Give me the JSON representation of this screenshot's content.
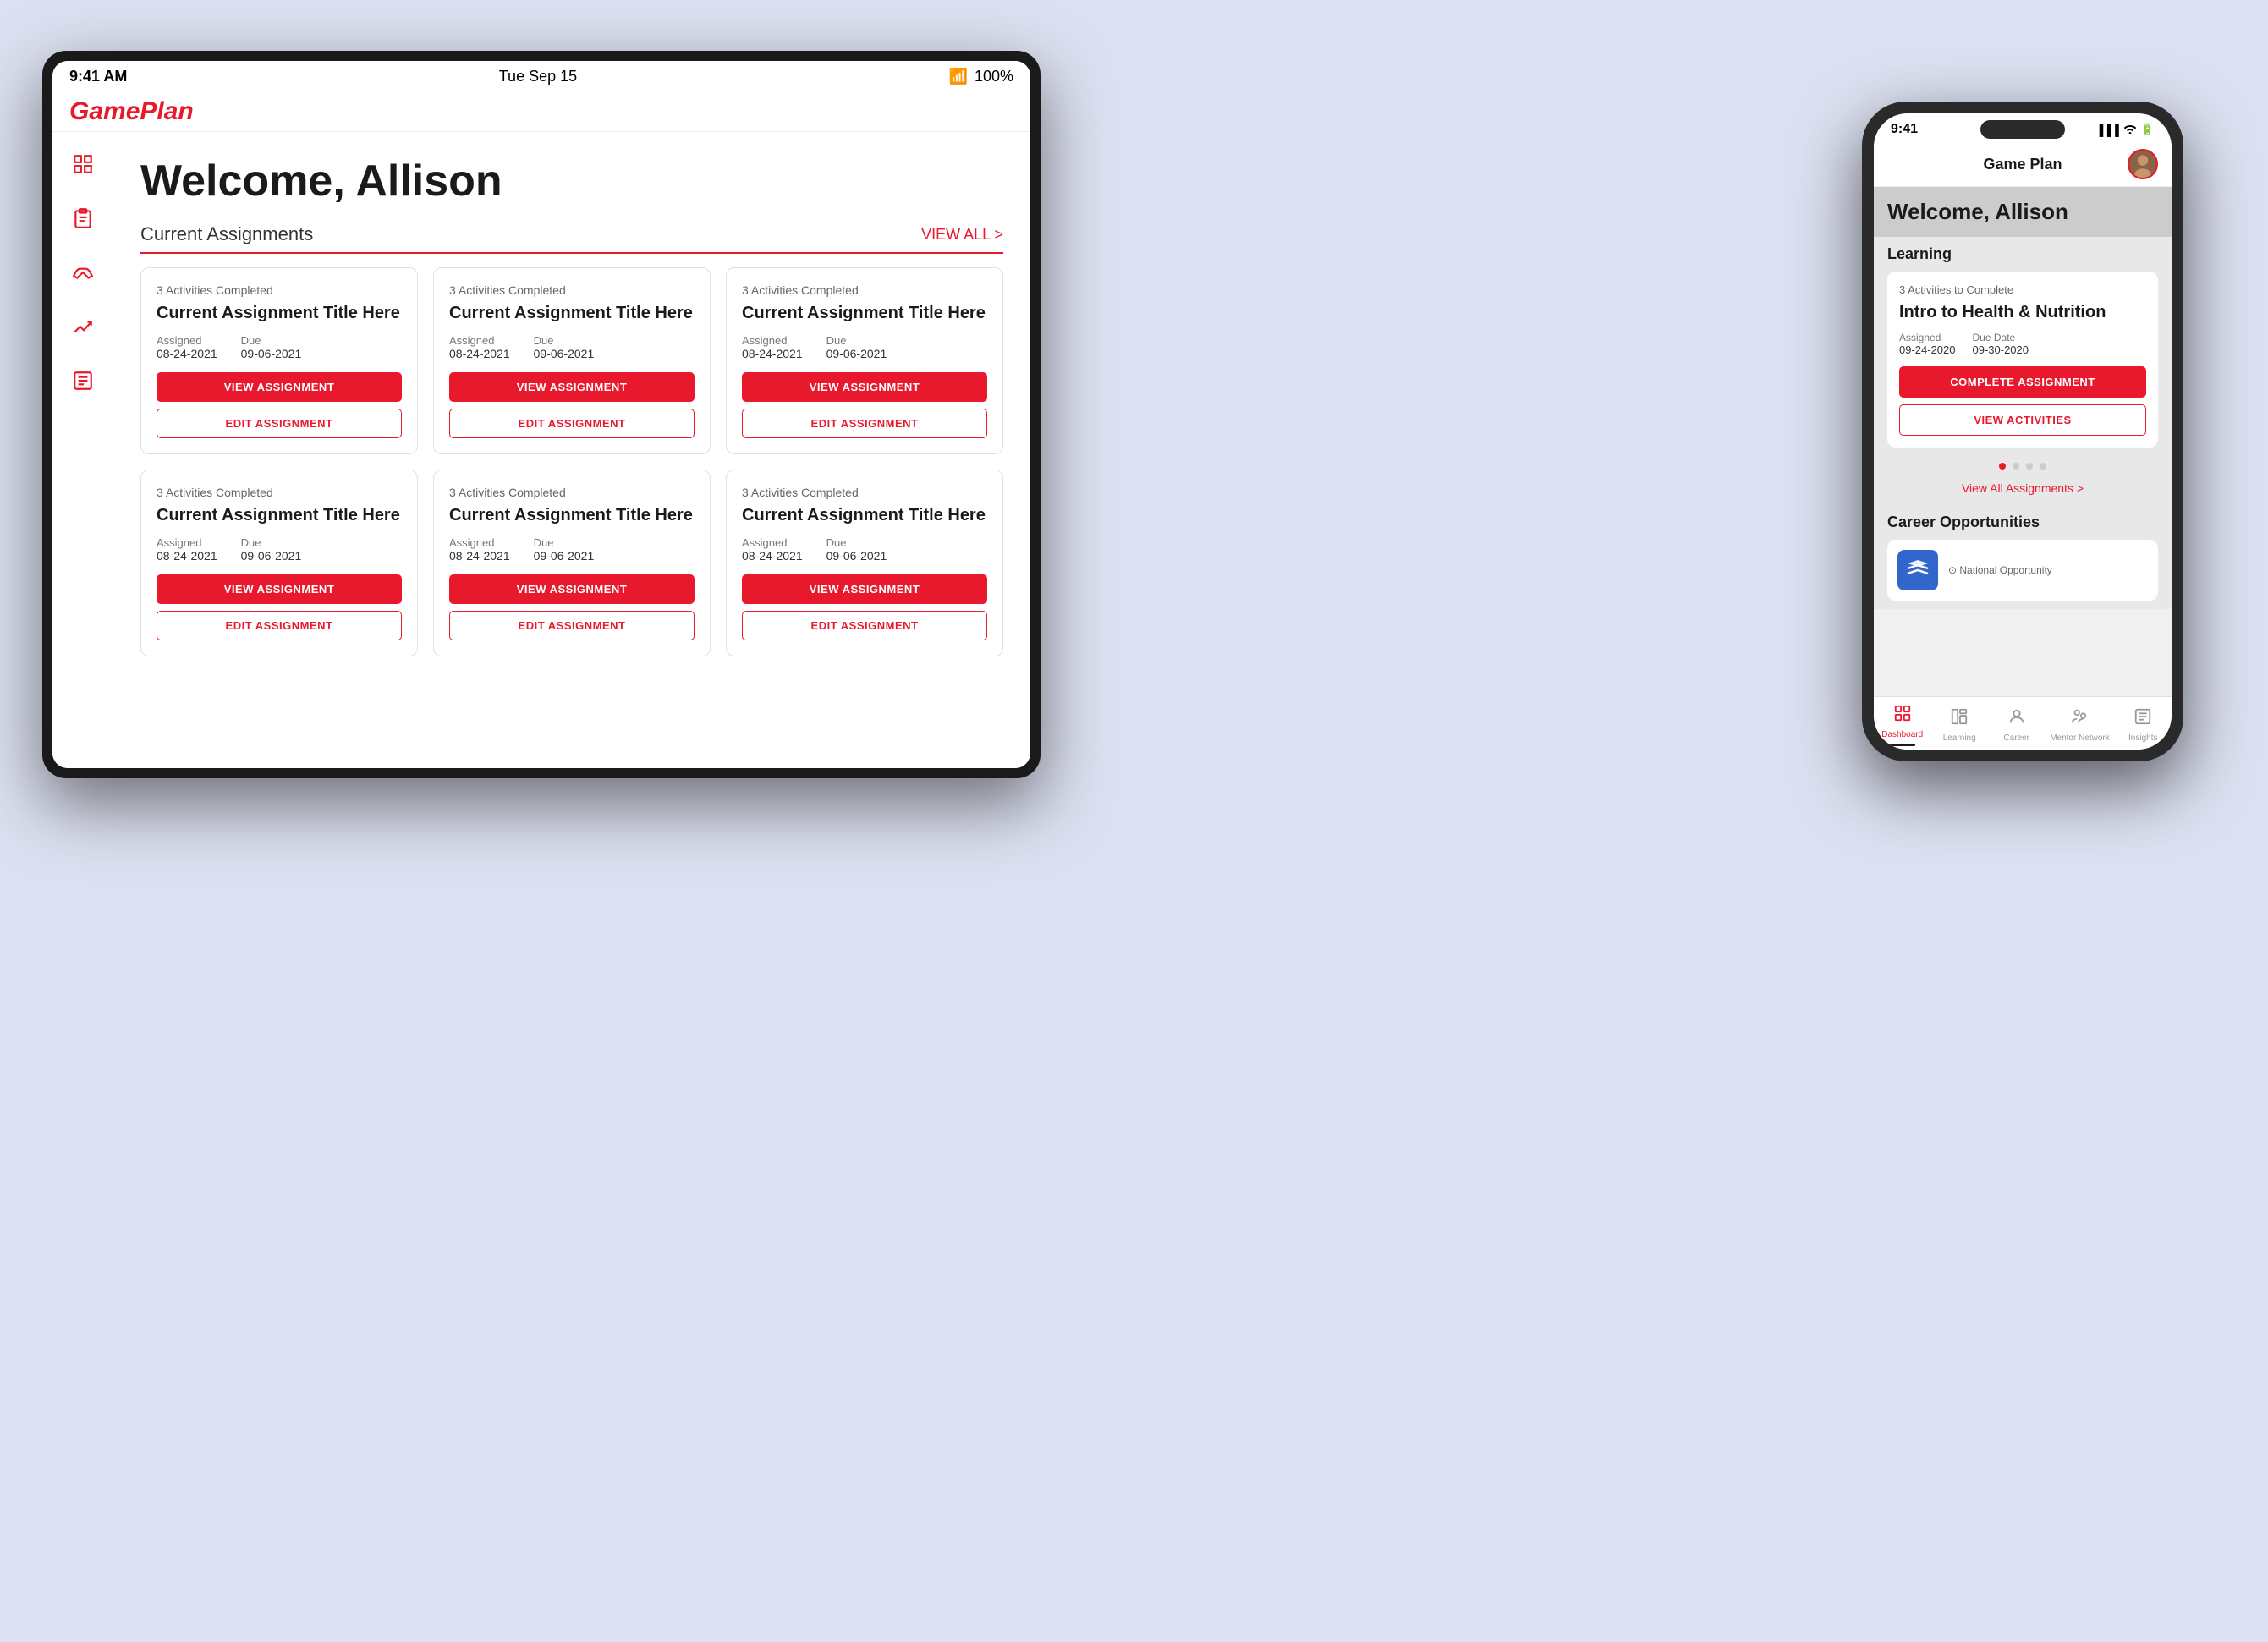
{
  "tablet": {
    "status_bar": {
      "time": "9:41 AM",
      "date": "Tue Sep 15",
      "wifi": "WiFi",
      "battery": "100%"
    },
    "logo": "GamePlan",
    "welcome": "Welcome, Allison",
    "current_assignments_label": "Current Assignments",
    "view_all_label": "VIEW ALL >",
    "sidebar_icons": [
      "grid",
      "clipboard",
      "handshake",
      "chart",
      "news"
    ],
    "assignment_cards": [
      {
        "activities": "3 Activities Completed",
        "title": "Current Assignment Title Here",
        "assigned_label": "Assigned",
        "assigned_date": "08-24-2021",
        "due_label": "Due",
        "due_date": "09-06-2021",
        "view_btn": "VIEW ASSIGNMENT",
        "edit_btn": "EDIT ASSIGNMENT"
      },
      {
        "activities": "3 Activities Completed",
        "title": "Current Assignment Title Here",
        "assigned_label": "Assigned",
        "assigned_date": "08-24-2021",
        "due_label": "Due",
        "due_date": "09-06-2021",
        "view_btn": "VIEW ASSIGNMENT",
        "edit_btn": "EDIT ASSIGNMENT"
      },
      {
        "activities": "3 Activities Completed",
        "title": "Current Assignment Title Here",
        "assigned_label": "Assigned",
        "assigned_date": "08-24-2021",
        "due_label": "Due",
        "due_date": "09-06-2021",
        "view_btn": "VIEW ASSIGNMENT",
        "edit_btn": "EDIT ASSIGNMENT"
      },
      {
        "activities": "3 Activities Completed",
        "title": "Current Assignment Title Here",
        "assigned_label": "Assigned",
        "assigned_date": "08-24-2021",
        "due_label": "Due",
        "due_date": "09-06-2021",
        "view_btn": "VIEW ASSIGNMENT",
        "edit_btn": "EDIT ASSIGNMENT"
      },
      {
        "activities": "3 Activities Completed",
        "title": "Current Assignment Title Here",
        "assigned_label": "Assigned",
        "assigned_date": "08-24-2021",
        "due_label": "Due",
        "due_date": "09-06-2021",
        "view_btn": "VIEW ASSIGNMENT",
        "edit_btn": "EDIT ASSIGNMENT"
      },
      {
        "activities": "3 Activities Completed",
        "title": "Current Assignment Title Here",
        "assigned_label": "Assigned",
        "assigned_date": "08-24-2021",
        "due_label": "Due",
        "due_date": "09-06-2021",
        "view_btn": "VIEW ASSIGNMENT",
        "edit_btn": "EDIT ASSIGNMENT"
      }
    ]
  },
  "phone": {
    "status_bar": {
      "time": "9:41",
      "signal": "●●●",
      "wifi": "WiFi",
      "battery": "■"
    },
    "nav_title": "Game Plan",
    "welcome": "Welcome, Allison",
    "learning_label": "Learning",
    "assignment_card": {
      "activities": "3 Activities to Complete",
      "title": "Intro to Health & Nutrition",
      "assigned_label": "Assigned",
      "assigned_date": "09-24-2020",
      "due_label": "Due Date",
      "due_date": "09-30-2020",
      "complete_btn": "COMPLETE ASSIGNMENT",
      "view_activities_btn": "VIEW ACTIVITIES"
    },
    "view_all": "View All Assignments >",
    "career_label": "Career Opportunities",
    "career_card": {
      "logo": "A",
      "type": "⊙ National Opportunity",
      "name": "National Opportunity"
    },
    "tabs": [
      {
        "icon": "dashboard",
        "label": "Dashboard",
        "active": true
      },
      {
        "icon": "learning",
        "label": "Learning",
        "active": false
      },
      {
        "icon": "career",
        "label": "Career",
        "active": false
      },
      {
        "icon": "mentor",
        "label": "Mentor Network",
        "active": false
      },
      {
        "icon": "insights",
        "label": "Insights",
        "active": false
      }
    ]
  }
}
